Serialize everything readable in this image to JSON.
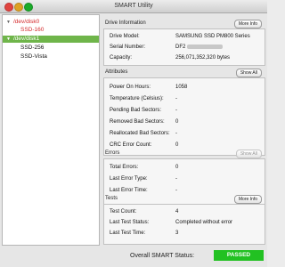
{
  "window": {
    "title": "SMART Utility"
  },
  "sidebar": {
    "items": [
      {
        "label": "/dev/disk0"
      },
      {
        "label": "SSD-160"
      },
      {
        "label": "/dev/disk1"
      },
      {
        "label": "SSD-256"
      },
      {
        "label": "SSD-Vista"
      }
    ]
  },
  "drive_info": {
    "title": "Drive Information",
    "button": "More Info",
    "rows": [
      {
        "label": "Drive Model:",
        "value": "SAMSUNG SSD PM800 Series"
      },
      {
        "label": "Serial Number:",
        "value": "DF2"
      },
      {
        "label": "Capacity:",
        "value": "256,071,352,320 bytes"
      }
    ]
  },
  "attributes": {
    "title": "Attributes",
    "button": "Show All",
    "rows": [
      {
        "label": "Power On Hours:",
        "value": "1058"
      },
      {
        "label": "Temperature (Celsius):",
        "value": "-"
      },
      {
        "label": "Pending Bad Sectors:",
        "value": "-"
      },
      {
        "label": "Removed Bad Sectors:",
        "value": "0"
      },
      {
        "label": "Reallocated Bad Sectors:",
        "value": "-"
      },
      {
        "label": "CRC Error Count:",
        "value": "0"
      }
    ]
  },
  "errors": {
    "title": "Errors",
    "button": "Show All",
    "rows": [
      {
        "label": "Total Errors:",
        "value": "0"
      },
      {
        "label": "Last Error Type:",
        "value": "-"
      },
      {
        "label": "Last Error Time:",
        "value": "-"
      }
    ]
  },
  "tests": {
    "title": "Tests",
    "button": "More Info",
    "rows": [
      {
        "label": "Test Count:",
        "value": "4"
      },
      {
        "label": "Last Test Status:",
        "value": "Completed without error"
      },
      {
        "label": "Last Test Time:",
        "value": "3"
      }
    ]
  },
  "status": {
    "label": "Overall SMART Status:",
    "value": "PASSED",
    "color": "#22c122"
  }
}
